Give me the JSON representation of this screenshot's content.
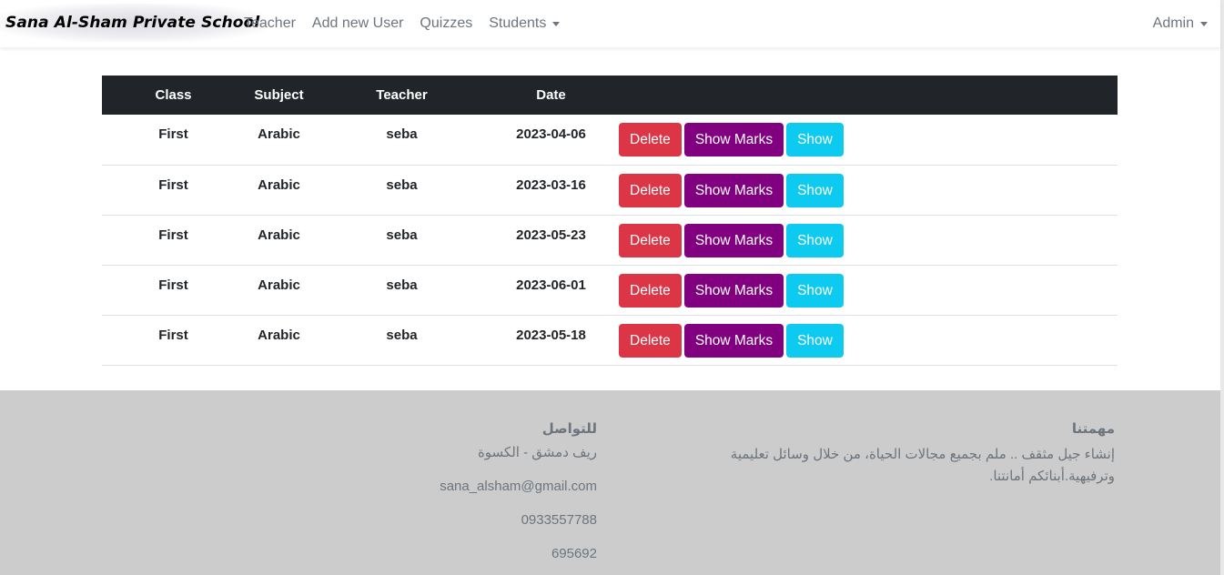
{
  "navbar": {
    "brand": "Sana Al-Sham Private School",
    "links": [
      "Teacher",
      "Add new User",
      "Quizzes",
      "Students"
    ],
    "user_menu": "Admin"
  },
  "table": {
    "headers": [
      "Class",
      "Subject",
      "Teacher",
      "Date"
    ],
    "rows": [
      {
        "class": "First",
        "subject": "Arabic",
        "teacher": "seba",
        "date": "2023-04-06"
      },
      {
        "class": "First",
        "subject": "Arabic",
        "teacher": "seba",
        "date": "2023-03-16"
      },
      {
        "class": "First",
        "subject": "Arabic",
        "teacher": "seba",
        "date": "2023-05-23"
      },
      {
        "class": "First",
        "subject": "Arabic",
        "teacher": "seba",
        "date": "2023-06-01"
      },
      {
        "class": "First",
        "subject": "Arabic",
        "teacher": "seba",
        "date": "2023-05-18"
      }
    ],
    "actions": {
      "delete": "Delete",
      "show_marks": "Show Marks",
      "show": "Show"
    }
  },
  "footer": {
    "contact": {
      "title": "للتواصل",
      "address": "ريف دمشق - الكسوة",
      "email": "sana_alsham@gmail.com",
      "phone": "0933557788",
      "phone2": "695692"
    },
    "mission": {
      "title": "مهمتنا",
      "text": "إنشاء جيل مثقف .. ملم بجميع مجالات الحياة، من خلال وسائل تعليمية وترفيهية.أبنائكم أمانتنا."
    }
  },
  "colors": {
    "delete": "#dc3545",
    "show_marks": "#800080",
    "show": "#0dcaf0",
    "header_bg": "#212529",
    "footer_bg": "#cccccc"
  }
}
